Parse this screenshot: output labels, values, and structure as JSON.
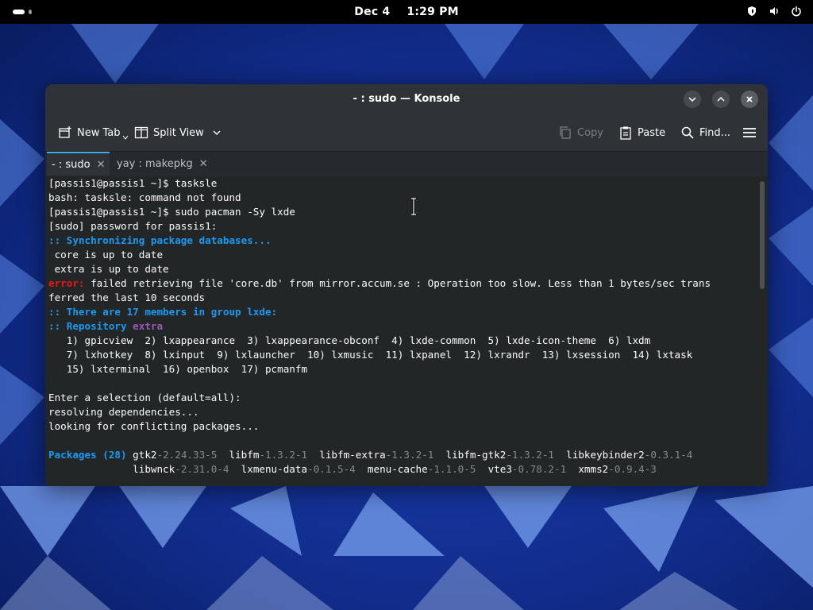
{
  "topbar": {
    "date": "Dec 4",
    "time": "1:29 PM",
    "icons": [
      "shield-icon",
      "volume-icon",
      "power-icon"
    ]
  },
  "window": {
    "title": "- : sudo — Konsole",
    "toolbar": {
      "new_tab": "New Tab",
      "split_view": "Split View",
      "copy": "Copy",
      "paste": "Paste",
      "find": "Find..."
    },
    "tabs": [
      {
        "label": "- : sudo",
        "close": "✕",
        "active": true
      },
      {
        "label": "yay : makepkg",
        "close": "✕",
        "active": false
      }
    ]
  },
  "terminal": {
    "lines": [
      "[passis1@passis1 ~]$ tasksle",
      "bash: tasksle: command not found",
      "[passis1@passis1 ~]$ sudo pacman -Sy lxde",
      "[sudo] password for passis1:",
      ":: Synchronizing package databases...",
      " core is up to date",
      " extra is up to date",
      "error: failed retrieving file 'core.db' from mirror.accum.se : Operation too slow. Less than 1 bytes/sec trans",
      "ferred the last 10 seconds",
      ":: There are 17 members in group lxde:",
      ":: Repository extra",
      "   1) gpicview  2) lxappearance  3) lxappearance-obconf  4) lxde-common  5) lxde-icon-theme  6) lxdm",
      "   7) lxhotkey  8) lxinput  9) lxlauncher  10) lxmusic  11) lxpanel  12) lxrandr  13) lxsession  14) lxtask",
      "   15) lxterminal  16) openbox  17) pcmanfm",
      "",
      "Enter a selection (default=all):",
      "resolving dependencies...",
      "looking for conflicting packages...",
      "",
      "Packages (28) gtk2-2.24.33-5  libfm-1.3.2-1  libfm-extra-1.3.2-1  libfm-gtk2-1.3.2-1  libkeybinder2-0.3.1-4",
      "              libwnck-2.31.0-4  lxmenu-data-0.1.5-4  menu-cache-1.1.0-5  vte3-0.78.2-1  xmms2-0.9.4-3"
    ]
  },
  "colors": {
    "accent_blue": "#1d99f3",
    "error_red": "#ed1515",
    "repo_purple": "#9b59b6",
    "version_gray": "#7f8c8d",
    "terminal_bg": "#232627"
  }
}
